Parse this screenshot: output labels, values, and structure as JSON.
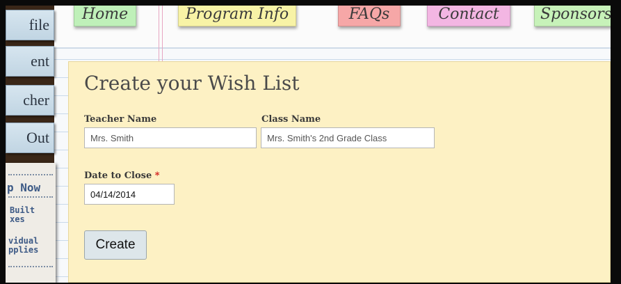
{
  "nav": {
    "tabs": [
      {
        "label": "Home"
      },
      {
        "label": "Program Info"
      },
      {
        "label": "FAQs"
      },
      {
        "label": "Contact"
      },
      {
        "label": "Sponsors"
      }
    ]
  },
  "sidebar": {
    "items": [
      {
        "label": "file"
      },
      {
        "label": "ent"
      },
      {
        "label": "cher"
      },
      {
        "label": "Out"
      }
    ],
    "shop_card": {
      "title": "p Now",
      "item1": "Built\nxes",
      "item2": "vidual\npplies"
    }
  },
  "form": {
    "title": "Create your Wish List",
    "teacher_label": "Teacher Name",
    "teacher_value": "Mrs. Smith",
    "class_label": "Class Name",
    "class_value": "Mrs. Smith's 2nd Grade Class",
    "date_label": "Date to Close",
    "date_required_marker": "*",
    "date_value": "04/14/2014",
    "submit_label": "Create"
  },
  "colors": {
    "form_background": "#fdf1c4",
    "required_marker": "#d01515",
    "tab_home": "#bff0b9",
    "tab_program": "#f8f3a6",
    "tab_faqs": "#f6a7a7",
    "tab_contact": "#f3b6e3",
    "tab_sponsors": "#c7f2b9"
  }
}
